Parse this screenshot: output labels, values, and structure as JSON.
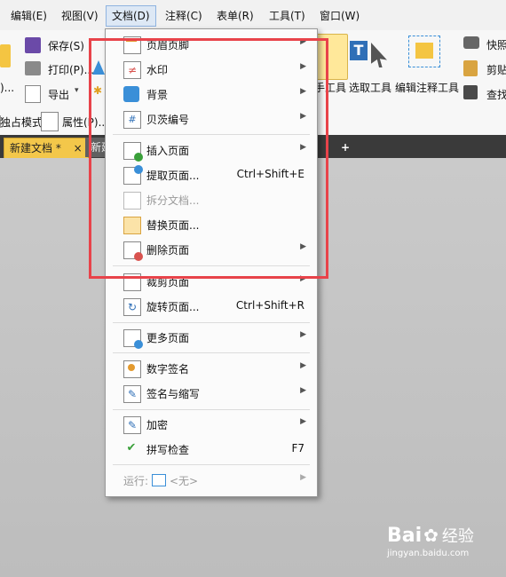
{
  "menubar": {
    "items": [
      "编辑(E)",
      "视图(V)",
      "文档(D)",
      "注释(C)",
      "表单(R)",
      "工具(T)",
      "窗口(W)"
    ]
  },
  "ribbon": {
    "save": "保存(S)",
    "print": "打印(P)...",
    "export": "导出",
    "partial_left": ")...",
    "read_mode": "独占模式",
    "properties": "属性(P)...",
    "hand_tool_partial": "手工具",
    "select_tool": "选取工具",
    "edit_annot_tool": "编辑注释工具",
    "snapshot": "快照",
    "clipboard": "剪贴",
    "find": "查找"
  },
  "tabs": {
    "active": "新建文档 *",
    "other": "新建",
    "close": "×",
    "add": "+"
  },
  "menu": {
    "items": [
      {
        "label": "页眉页脚",
        "arrow": "▶"
      },
      {
        "label": "水印",
        "arrow": "▶"
      },
      {
        "label": "背景",
        "arrow": "▶"
      },
      {
        "label": "贝茨编号",
        "arrow": "▶"
      },
      {
        "label": "插入页面",
        "arrow": "▶"
      },
      {
        "label": "提取页面...",
        "shortcut": "Ctrl+Shift+E"
      },
      {
        "label": "拆分文档..."
      },
      {
        "label": "替换页面..."
      },
      {
        "label": "删除页面",
        "arrow": "▶"
      },
      {
        "label": "裁剪页面",
        "arrow": "▶"
      },
      {
        "label": "旋转页面...",
        "shortcut": "Ctrl+Shift+R"
      },
      {
        "label": "更多页面",
        "arrow": "▶"
      },
      {
        "label": "数字签名",
        "arrow": "▶"
      },
      {
        "label": "签名与缩写",
        "arrow": "▶"
      },
      {
        "label": "加密",
        "arrow": "▶"
      },
      {
        "label": "拼写检查",
        "shortcut": "F7"
      },
      {
        "label": "运行:",
        "value": "<无>",
        "arrow": "▶"
      }
    ]
  },
  "watermark": {
    "brand": "Bai",
    "brand2": "经验",
    "url": "jingyan.baidu.com"
  },
  "colors": {
    "highlight": "#e8434a",
    "tab_active": "#f3c74a",
    "accent": "#2f6fb7"
  }
}
